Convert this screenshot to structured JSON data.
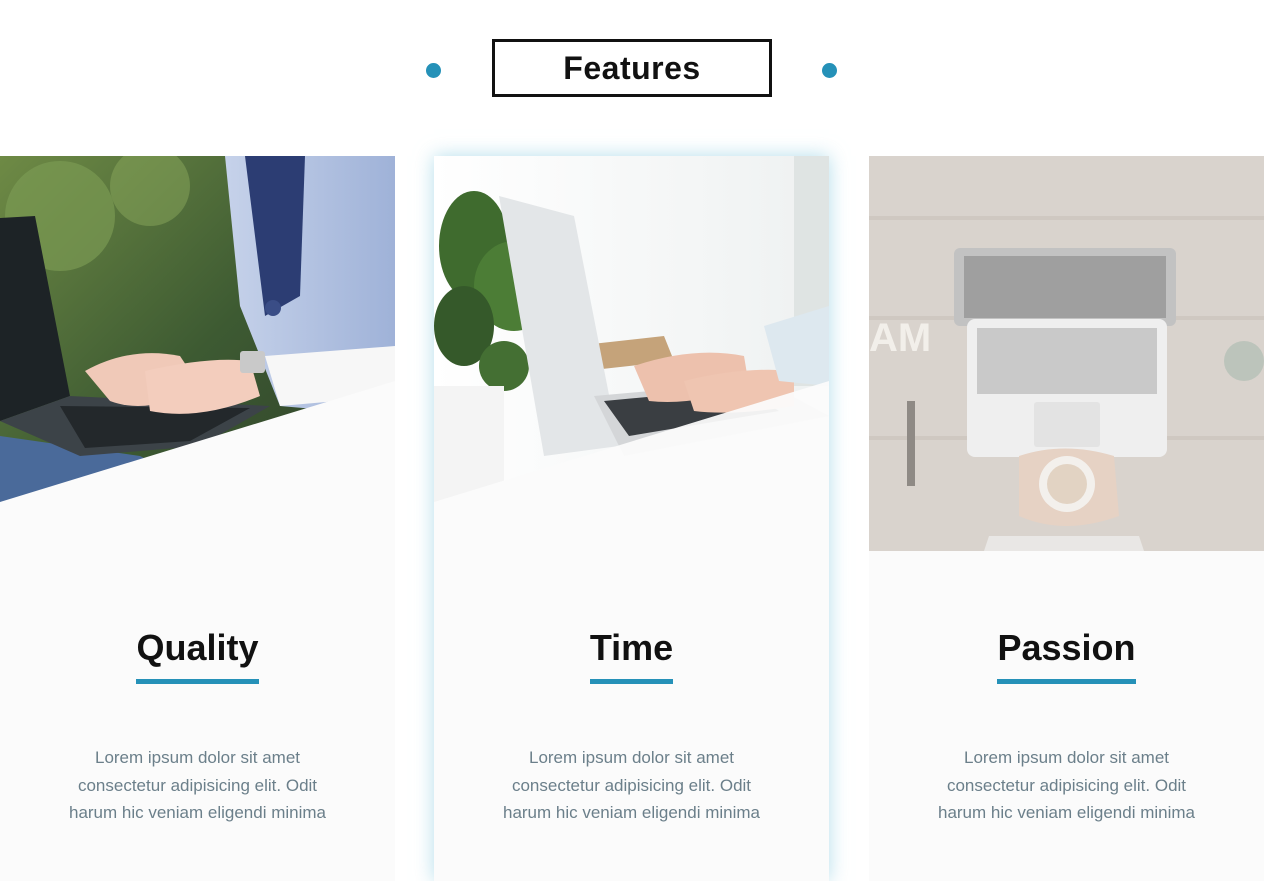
{
  "section": {
    "title": "Features",
    "accent_color": "#2591b8"
  },
  "cards": [
    {
      "title": "Quality",
      "text": "Lorem ipsum dolor sit amet consectetur adipisicing elit. Odit harum hic veniam eligendi minima",
      "image": "woman-typing-on-laptop-photo"
    },
    {
      "title": "Time",
      "text": "Lorem ipsum dolor sit amet consectetur adipisicing elit. Odit harum hic veniam eligendi minima",
      "image": "hands-on-laptop-with-plant-photo"
    },
    {
      "title": "Passion",
      "text": "Lorem ipsum dolor sit amet consectetur adipisicing elit. Odit harum hic veniam eligendi minima",
      "image": "laptop-and-coffee-on-desk-photo"
    }
  ]
}
